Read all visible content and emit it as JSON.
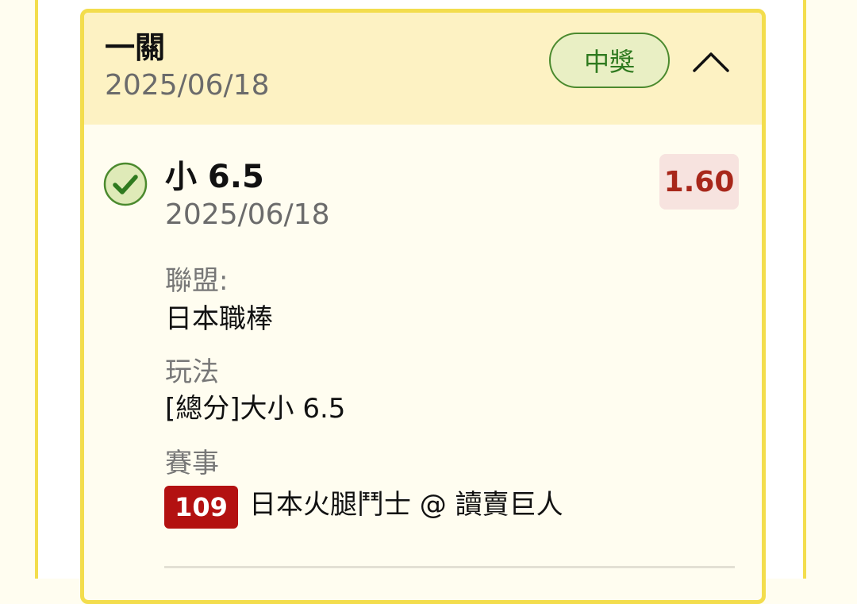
{
  "card": {
    "title": "一關",
    "date": "2025/06/18",
    "status": "中獎",
    "collapse_icon": "chevron-up-icon"
  },
  "selection": {
    "title": "小 6.5",
    "date": "2025/06/18",
    "odds": "1.60",
    "status_icon": "check-circle-icon",
    "league_label": "聯盟:",
    "league_value": "日本職棒",
    "play_label": "玩法",
    "play_value": "[總分]大小 6.5",
    "event_label": "賽事",
    "event_number": "109",
    "event_name": "日本火腿鬥士 @ 讀賣巨人"
  },
  "colors": {
    "accent_border": "#f3dd4d",
    "header_bg": "#fdf2c3",
    "win_green": "#2f7a1f",
    "odds_red": "#a8271a",
    "event_badge_red": "#b31111"
  }
}
